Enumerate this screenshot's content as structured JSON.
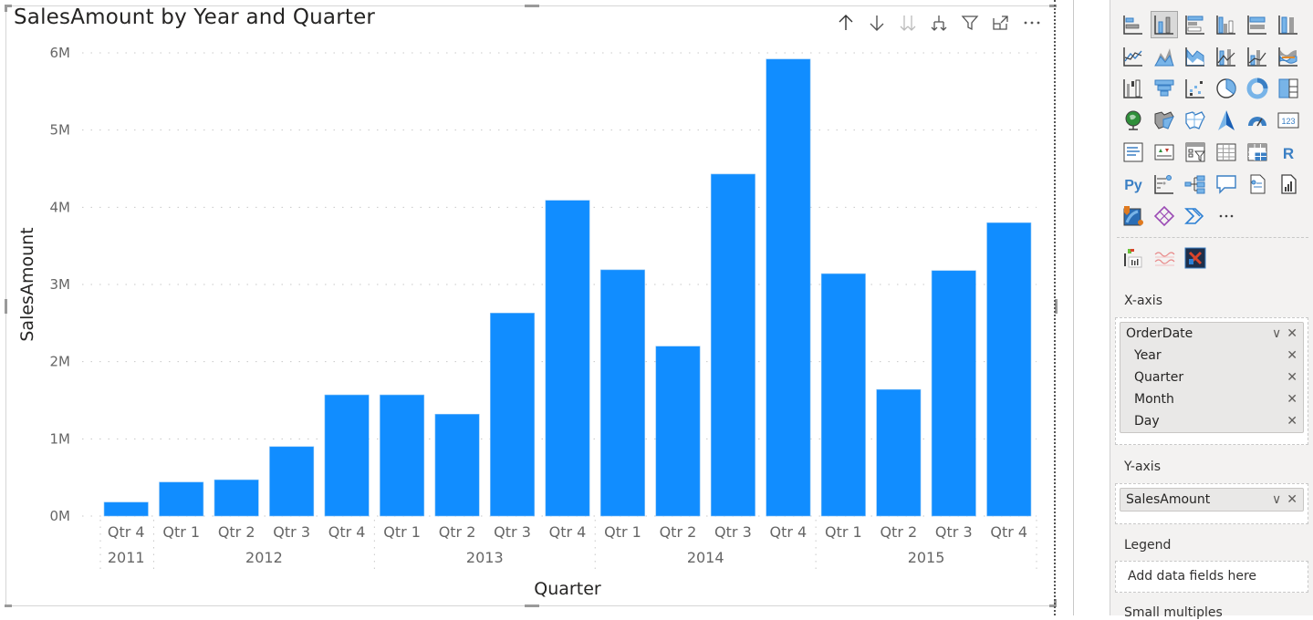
{
  "visual": {
    "title": "SalesAmount by Year and Quarter",
    "header_icons": [
      {
        "name": "drill-up-icon",
        "glyph": "arrow-up"
      },
      {
        "name": "drill-down-icon",
        "glyph": "arrow-down"
      },
      {
        "name": "next-level-icon",
        "glyph": "double-arrow-down"
      },
      {
        "name": "expand-hierarchy-icon",
        "glyph": "fork-down"
      },
      {
        "name": "filter-icon",
        "glyph": "funnel"
      },
      {
        "name": "focus-mode-icon",
        "glyph": "expand"
      },
      {
        "name": "more-options-icon",
        "glyph": "ellipsis"
      }
    ]
  },
  "chart_data": {
    "type": "bar",
    "title": "SalesAmount by Year and Quarter",
    "xlabel": "Quarter",
    "ylabel": "SalesAmount",
    "ylim": [
      0,
      6000000
    ],
    "yticks": [
      0,
      1000000,
      2000000,
      3000000,
      4000000,
      5000000,
      6000000
    ],
    "ytick_labels": [
      "0M",
      "1M",
      "2M",
      "3M",
      "4M",
      "5M",
      "6M"
    ],
    "grid": true,
    "bar_color": "#118DFF",
    "categories": [
      "Qtr 4",
      "Qtr 1",
      "Qtr 2",
      "Qtr 3",
      "Qtr 4",
      "Qtr 1",
      "Qtr 2",
      "Qtr 3",
      "Qtr 4",
      "Qtr 1",
      "Qtr 2",
      "Qtr 3",
      "Qtr 4",
      "Qtr 1",
      "Qtr 2",
      "Qtr 3",
      "Qtr 4"
    ],
    "groups": [
      {
        "label": "2011",
        "count": 1
      },
      {
        "label": "2012",
        "count": 4
      },
      {
        "label": "2013",
        "count": 4
      },
      {
        "label": "2014",
        "count": 4
      },
      {
        "label": "2015",
        "count": 4
      }
    ],
    "series": [
      {
        "name": "SalesAmount",
        "values": [
          180000,
          440000,
          470000,
          900000,
          1570000,
          1570000,
          1320000,
          2630000,
          4090000,
          3190000,
          2200000,
          4430000,
          5920000,
          3140000,
          1640000,
          3180000,
          3800000
        ]
      }
    ]
  },
  "panel": {
    "viz_icons": [
      "stacked-bar-chart-icon",
      "stacked-column-chart-icon",
      "clustered-bar-chart-icon",
      "clustered-column-chart-icon",
      "100-stacked-bar-chart-icon",
      "100-stacked-column-chart-icon",
      "line-chart-icon",
      "area-chart-icon",
      "stacked-area-chart-icon",
      "line-stacked-column-chart-icon",
      "line-clustered-column-chart-icon",
      "ribbon-chart-icon",
      "waterfall-chart-icon",
      "funnel-icon",
      "scatter-chart-icon",
      "pie-chart-icon",
      "donut-chart-icon",
      "treemap-icon",
      "map-icon",
      "filled-map-icon",
      "shape-map-icon",
      "azure-map-icon",
      "gauge-icon",
      "card-icon",
      "multi-row-card-icon",
      "kpi-icon",
      "slicer-icon",
      "table-icon",
      "matrix-icon",
      "r-visual-icon",
      "python-visual-icon",
      "key-influencers-icon",
      "decomposition-tree-icon",
      "qa-icon",
      "smart-narrative-icon",
      "paginated-report-icon",
      "arcgis-map-icon",
      "power-apps-icon",
      "power-automate-icon",
      "more-visuals-icon"
    ],
    "selected_viz": "stacked-column-chart-icon",
    "custom_icons": [
      "custom-visual-1-icon",
      "custom-visual-2-icon",
      "custom-visual-3-icon"
    ],
    "x_axis": {
      "label": "X-axis",
      "field": "OrderDate",
      "levels": [
        "Year",
        "Quarter",
        "Month",
        "Day"
      ]
    },
    "y_axis": {
      "label": "Y-axis",
      "field": "SalesAmount"
    },
    "legend": {
      "label": "Legend",
      "placeholder": "Add data fields here"
    },
    "small_multiples": {
      "label": "Small multiples"
    },
    "glyphs": {
      "chevron": "∨",
      "close": "✕"
    }
  }
}
